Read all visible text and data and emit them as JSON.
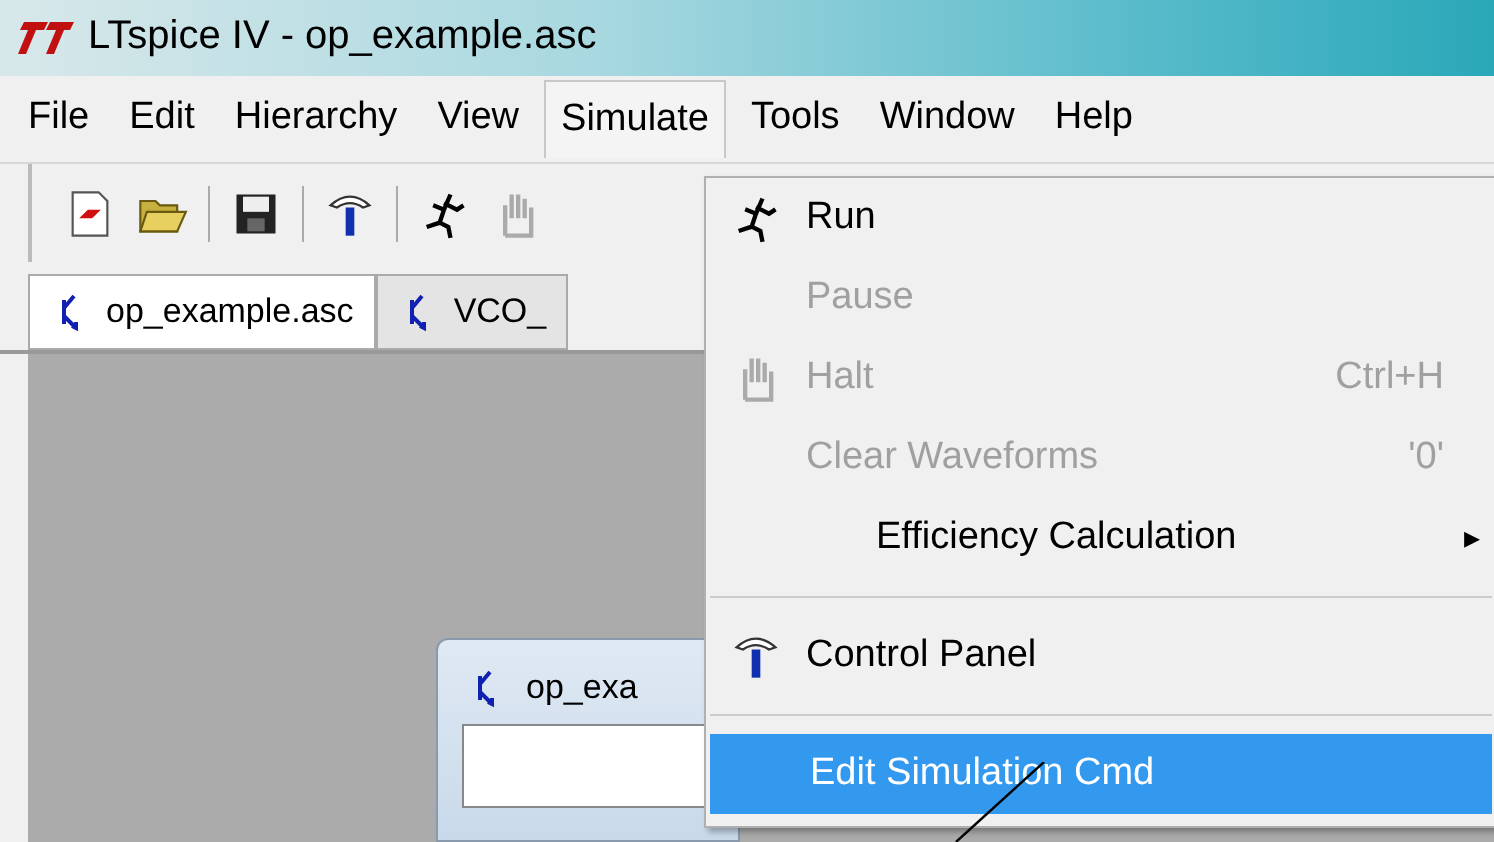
{
  "window": {
    "title": "LTspice IV - op_example.asc"
  },
  "menu_bar": [
    {
      "label": "File",
      "selected": false
    },
    {
      "label": "Edit",
      "selected": false
    },
    {
      "label": "Hierarchy",
      "selected": false
    },
    {
      "label": "View",
      "selected": false
    },
    {
      "label": "Simulate",
      "selected": true
    },
    {
      "label": "Tools",
      "selected": false
    },
    {
      "label": "Window",
      "selected": false
    },
    {
      "label": "Help",
      "selected": false
    }
  ],
  "toolbar": [
    {
      "kind": "new"
    },
    {
      "kind": "open"
    },
    {
      "kind": "sep"
    },
    {
      "kind": "save"
    },
    {
      "kind": "sep"
    },
    {
      "kind": "hammer"
    },
    {
      "kind": "sep"
    },
    {
      "kind": "run"
    },
    {
      "kind": "hand"
    }
  ],
  "tabs": [
    {
      "label": "op_example.asc",
      "selected": true
    },
    {
      "label": "VCO_",
      "selected": false
    }
  ],
  "child_window": {
    "title": "op_exa"
  },
  "menu": [
    {
      "kind": "run",
      "label": "Run",
      "disabled": false,
      "selected": false
    },
    {
      "kind": "item",
      "label": "Pause",
      "disabled": true,
      "selected": false
    },
    {
      "kind": "halt",
      "label": "Halt",
      "shortcut": "Ctrl+H",
      "disabled": true,
      "selected": false
    },
    {
      "kind": "item",
      "label": "Clear Waveforms",
      "shortcut": "'0'",
      "disabled": true,
      "selected": false
    },
    {
      "kind": "submenu",
      "label": "Efficiency Calculation",
      "arrow": "▸",
      "disabled": false,
      "selected": false
    },
    {
      "kind": "separator"
    },
    {
      "kind": "panel",
      "label": "Control Panel",
      "disabled": false,
      "selected": false
    },
    {
      "kind": "separator"
    },
    {
      "kind": "item",
      "label": "Edit Simulation Cmd",
      "disabled": false,
      "selected": true
    }
  ]
}
